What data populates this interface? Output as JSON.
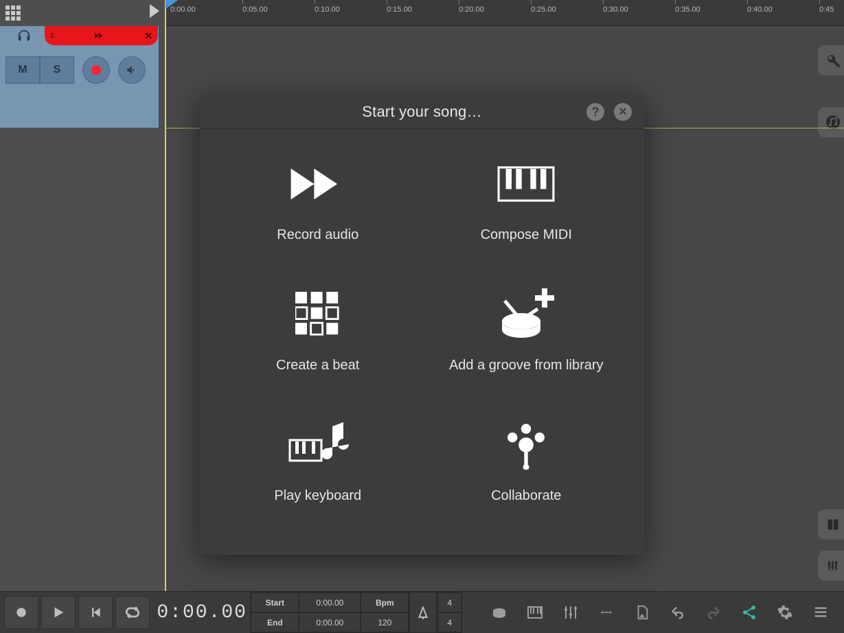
{
  "timeline_ticks": [
    "0:00.00",
    "0:05.00",
    "0:10.00",
    "0:15.00",
    "0:20.00",
    "0:25.00",
    "0:30.00",
    "0:35.00",
    "0:40.00",
    "0:45"
  ],
  "track": {
    "number": "1:",
    "mute": "M",
    "solo": "S"
  },
  "modal": {
    "title": "Start your song…",
    "options": {
      "record_audio": "Record audio",
      "compose_midi": "Compose MIDI",
      "create_beat": "Create a beat",
      "add_groove": "Add a groove from library",
      "play_keyboard": "Play keyboard",
      "collaborate": "Collaborate"
    }
  },
  "transport": {
    "time": "0:00.00",
    "start_label": "Start",
    "end_label": "End",
    "bpm_label": "Bpm",
    "start_val": "0:00.00",
    "end_val": "0:00.00",
    "bpm_val": "120",
    "ts_num": "4",
    "ts_den": "4"
  }
}
